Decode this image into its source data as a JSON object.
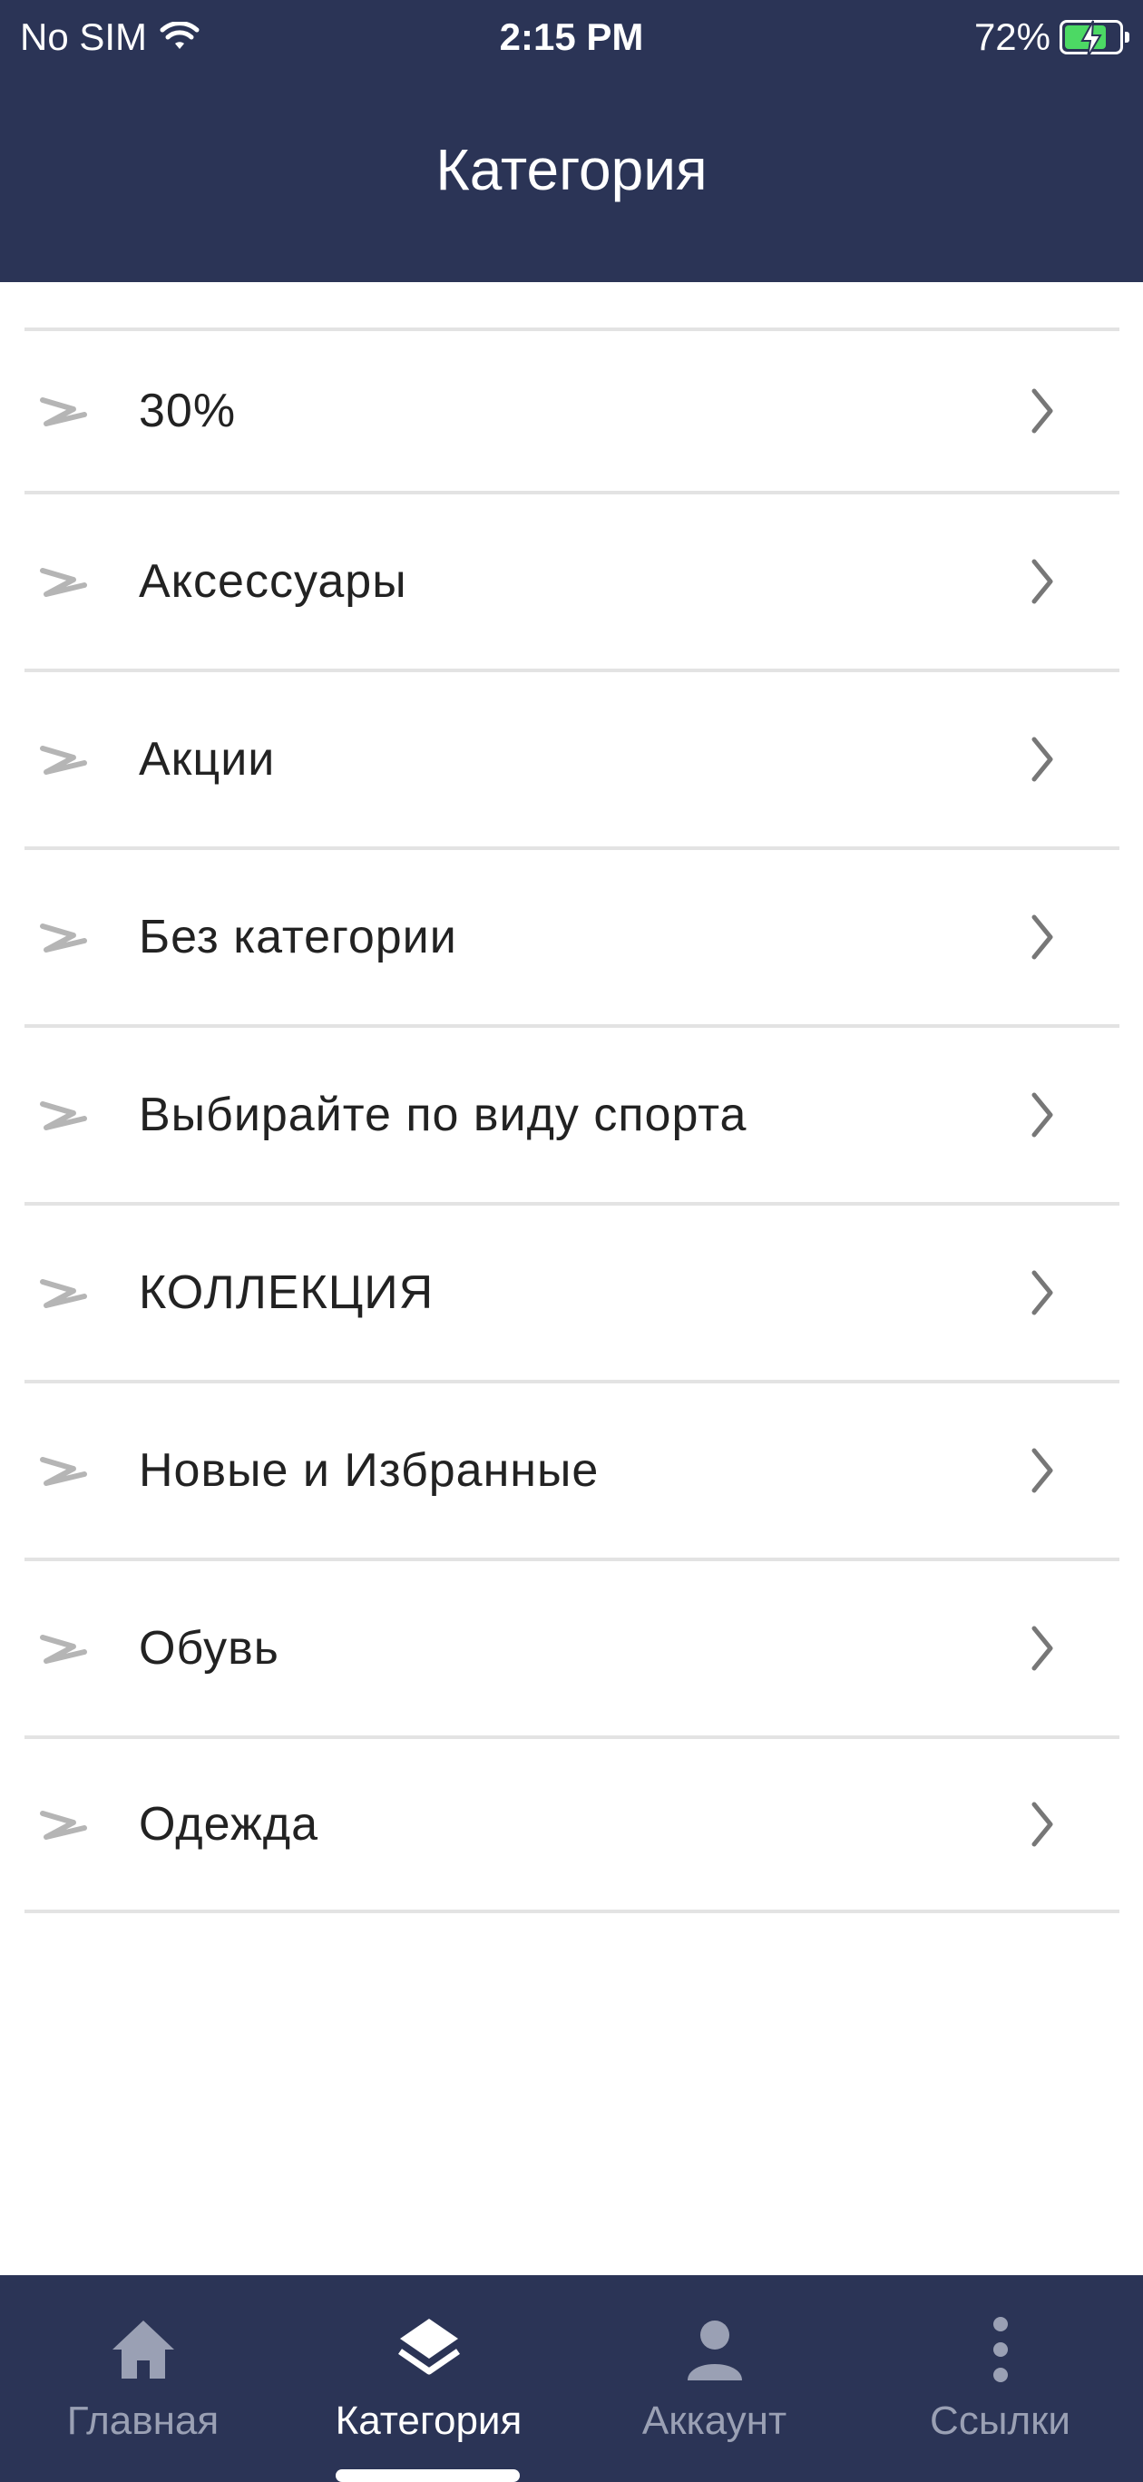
{
  "status_bar": {
    "carrier": "No SIM",
    "time": "2:15 PM",
    "battery": "72%"
  },
  "header": {
    "title": "Категория"
  },
  "categories": [
    {
      "label": "30%"
    },
    {
      "label": "Аксессуары"
    },
    {
      "label": "Акции"
    },
    {
      "label": "Без категории"
    },
    {
      "label": "Выбирайте по виду спорта"
    },
    {
      "label": "КОЛЛЕКЦИЯ"
    },
    {
      "label": "Новые и Избранные"
    },
    {
      "label": "Обувь"
    },
    {
      "label": "Одежда"
    }
  ],
  "tabbar": {
    "active": "category",
    "tabs": [
      {
        "id": "home",
        "label": "Главная",
        "icon": "home-icon"
      },
      {
        "id": "category",
        "label": "Категория",
        "icon": "layers-icon"
      },
      {
        "id": "account",
        "label": "Аккаунт",
        "icon": "user-icon"
      },
      {
        "id": "links",
        "label": "Ссылки",
        "icon": "more-vertical-icon"
      }
    ]
  },
  "colors": {
    "header_bg": "#2b3456",
    "tab_inactive": "#9aa0b4",
    "tab_active": "#ffffff",
    "divider": "#e3e3e3"
  }
}
